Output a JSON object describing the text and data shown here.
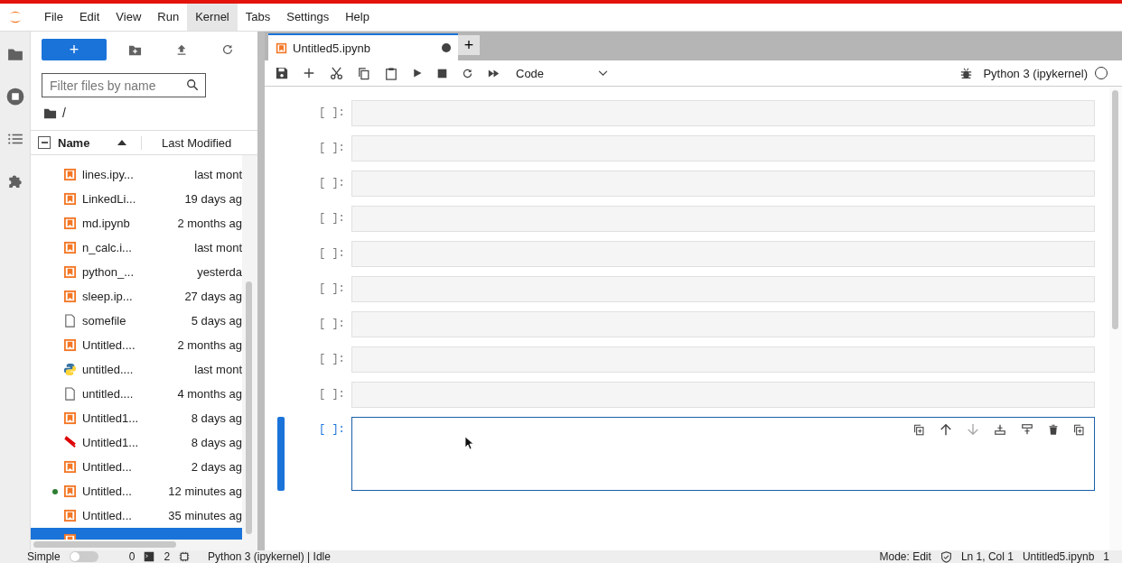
{
  "menu": [
    {
      "label": "File",
      "selected": false
    },
    {
      "label": "Edit",
      "selected": false
    },
    {
      "label": "View",
      "selected": false
    },
    {
      "label": "Run",
      "selected": false
    },
    {
      "label": "Kernel",
      "selected": true
    },
    {
      "label": "Tabs",
      "selected": false
    },
    {
      "label": "Settings",
      "selected": false
    },
    {
      "label": "Help",
      "selected": false
    }
  ],
  "new_button": "+",
  "filter": {
    "placeholder": "Filter files by name"
  },
  "path": "/",
  "columns": {
    "name": "Name",
    "modified": "Last Modified",
    "select_all_partial": true
  },
  "files": [
    {
      "name": "lines.ipy...",
      "modified": "last mont",
      "kind": "notebook",
      "running": false,
      "selected": false
    },
    {
      "name": "LinkedLi...",
      "modified": "19 days ag",
      "kind": "notebook",
      "running": false,
      "selected": false
    },
    {
      "name": "md.ipynb",
      "modified": "2 months ag",
      "kind": "notebook",
      "running": false,
      "selected": false
    },
    {
      "name": "n_calc.i...",
      "modified": "last mont",
      "kind": "notebook",
      "running": false,
      "selected": false
    },
    {
      "name": "python_...",
      "modified": "yesterda",
      "kind": "notebook",
      "running": false,
      "selected": false
    },
    {
      "name": "sleep.ip...",
      "modified": "27 days ag",
      "kind": "notebook",
      "running": false,
      "selected": false
    },
    {
      "name": "somefile",
      "modified": "5 days ag",
      "kind": "file",
      "running": false,
      "selected": false
    },
    {
      "name": "Untitled....",
      "modified": "2 months ag",
      "kind": "notebook",
      "running": false,
      "selected": false
    },
    {
      "name": "untitled....",
      "modified": "last mont",
      "kind": "python",
      "running": false,
      "selected": false
    },
    {
      "name": "untitled....",
      "modified": "4 months ag",
      "kind": "file",
      "running": false,
      "selected": false
    },
    {
      "name": "Untitled1...",
      "modified": "8 days ag",
      "kind": "notebook",
      "running": false,
      "selected": false
    },
    {
      "name": "Untitled1...",
      "modified": "8 days ag",
      "kind": "pdf",
      "running": false,
      "selected": false
    },
    {
      "name": "Untitled...",
      "modified": "2 days ag",
      "kind": "notebook",
      "running": false,
      "selected": false
    },
    {
      "name": "Untitled...",
      "modified": "12 minutes ag",
      "kind": "notebook",
      "running": true,
      "selected": false
    },
    {
      "name": "Untitled...",
      "modified": "35 minutes ag",
      "kind": "notebook",
      "running": false,
      "selected": false
    },
    {
      "kind": "notebook",
      "running": false,
      "selected": true
    }
  ],
  "tabs": [
    {
      "title": "Untitled5.ipynb",
      "selected": true,
      "unsaved": true
    }
  ],
  "add_tab": "+",
  "cell_type": "Code",
  "kernel": "Python 3 (ipykernel)",
  "cells": [
    {
      "prompt": "[ ]:",
      "active": false
    },
    {
      "prompt": "[ ]:",
      "active": false
    },
    {
      "prompt": "[ ]:",
      "active": false
    },
    {
      "prompt": "[ ]:",
      "active": false
    },
    {
      "prompt": "[ ]:",
      "active": false
    },
    {
      "prompt": "[ ]:",
      "active": false
    },
    {
      "prompt": "[ ]:",
      "active": false
    },
    {
      "prompt": "[ ]:",
      "active": false
    },
    {
      "prompt": "[ ]:",
      "active": false
    },
    {
      "prompt": "[ ]:",
      "active": true
    }
  ],
  "status_bar": {
    "mode_label": "Simple",
    "simple_on": false,
    "count_a": "0",
    "count_b": "2",
    "kernel_status": "Python 3 (ipykernel) | Idle",
    "mode": "Mode: Edit",
    "position": "Ln 1, Col 1",
    "file": "Untitled5.ipynb",
    "extra": "1"
  }
}
